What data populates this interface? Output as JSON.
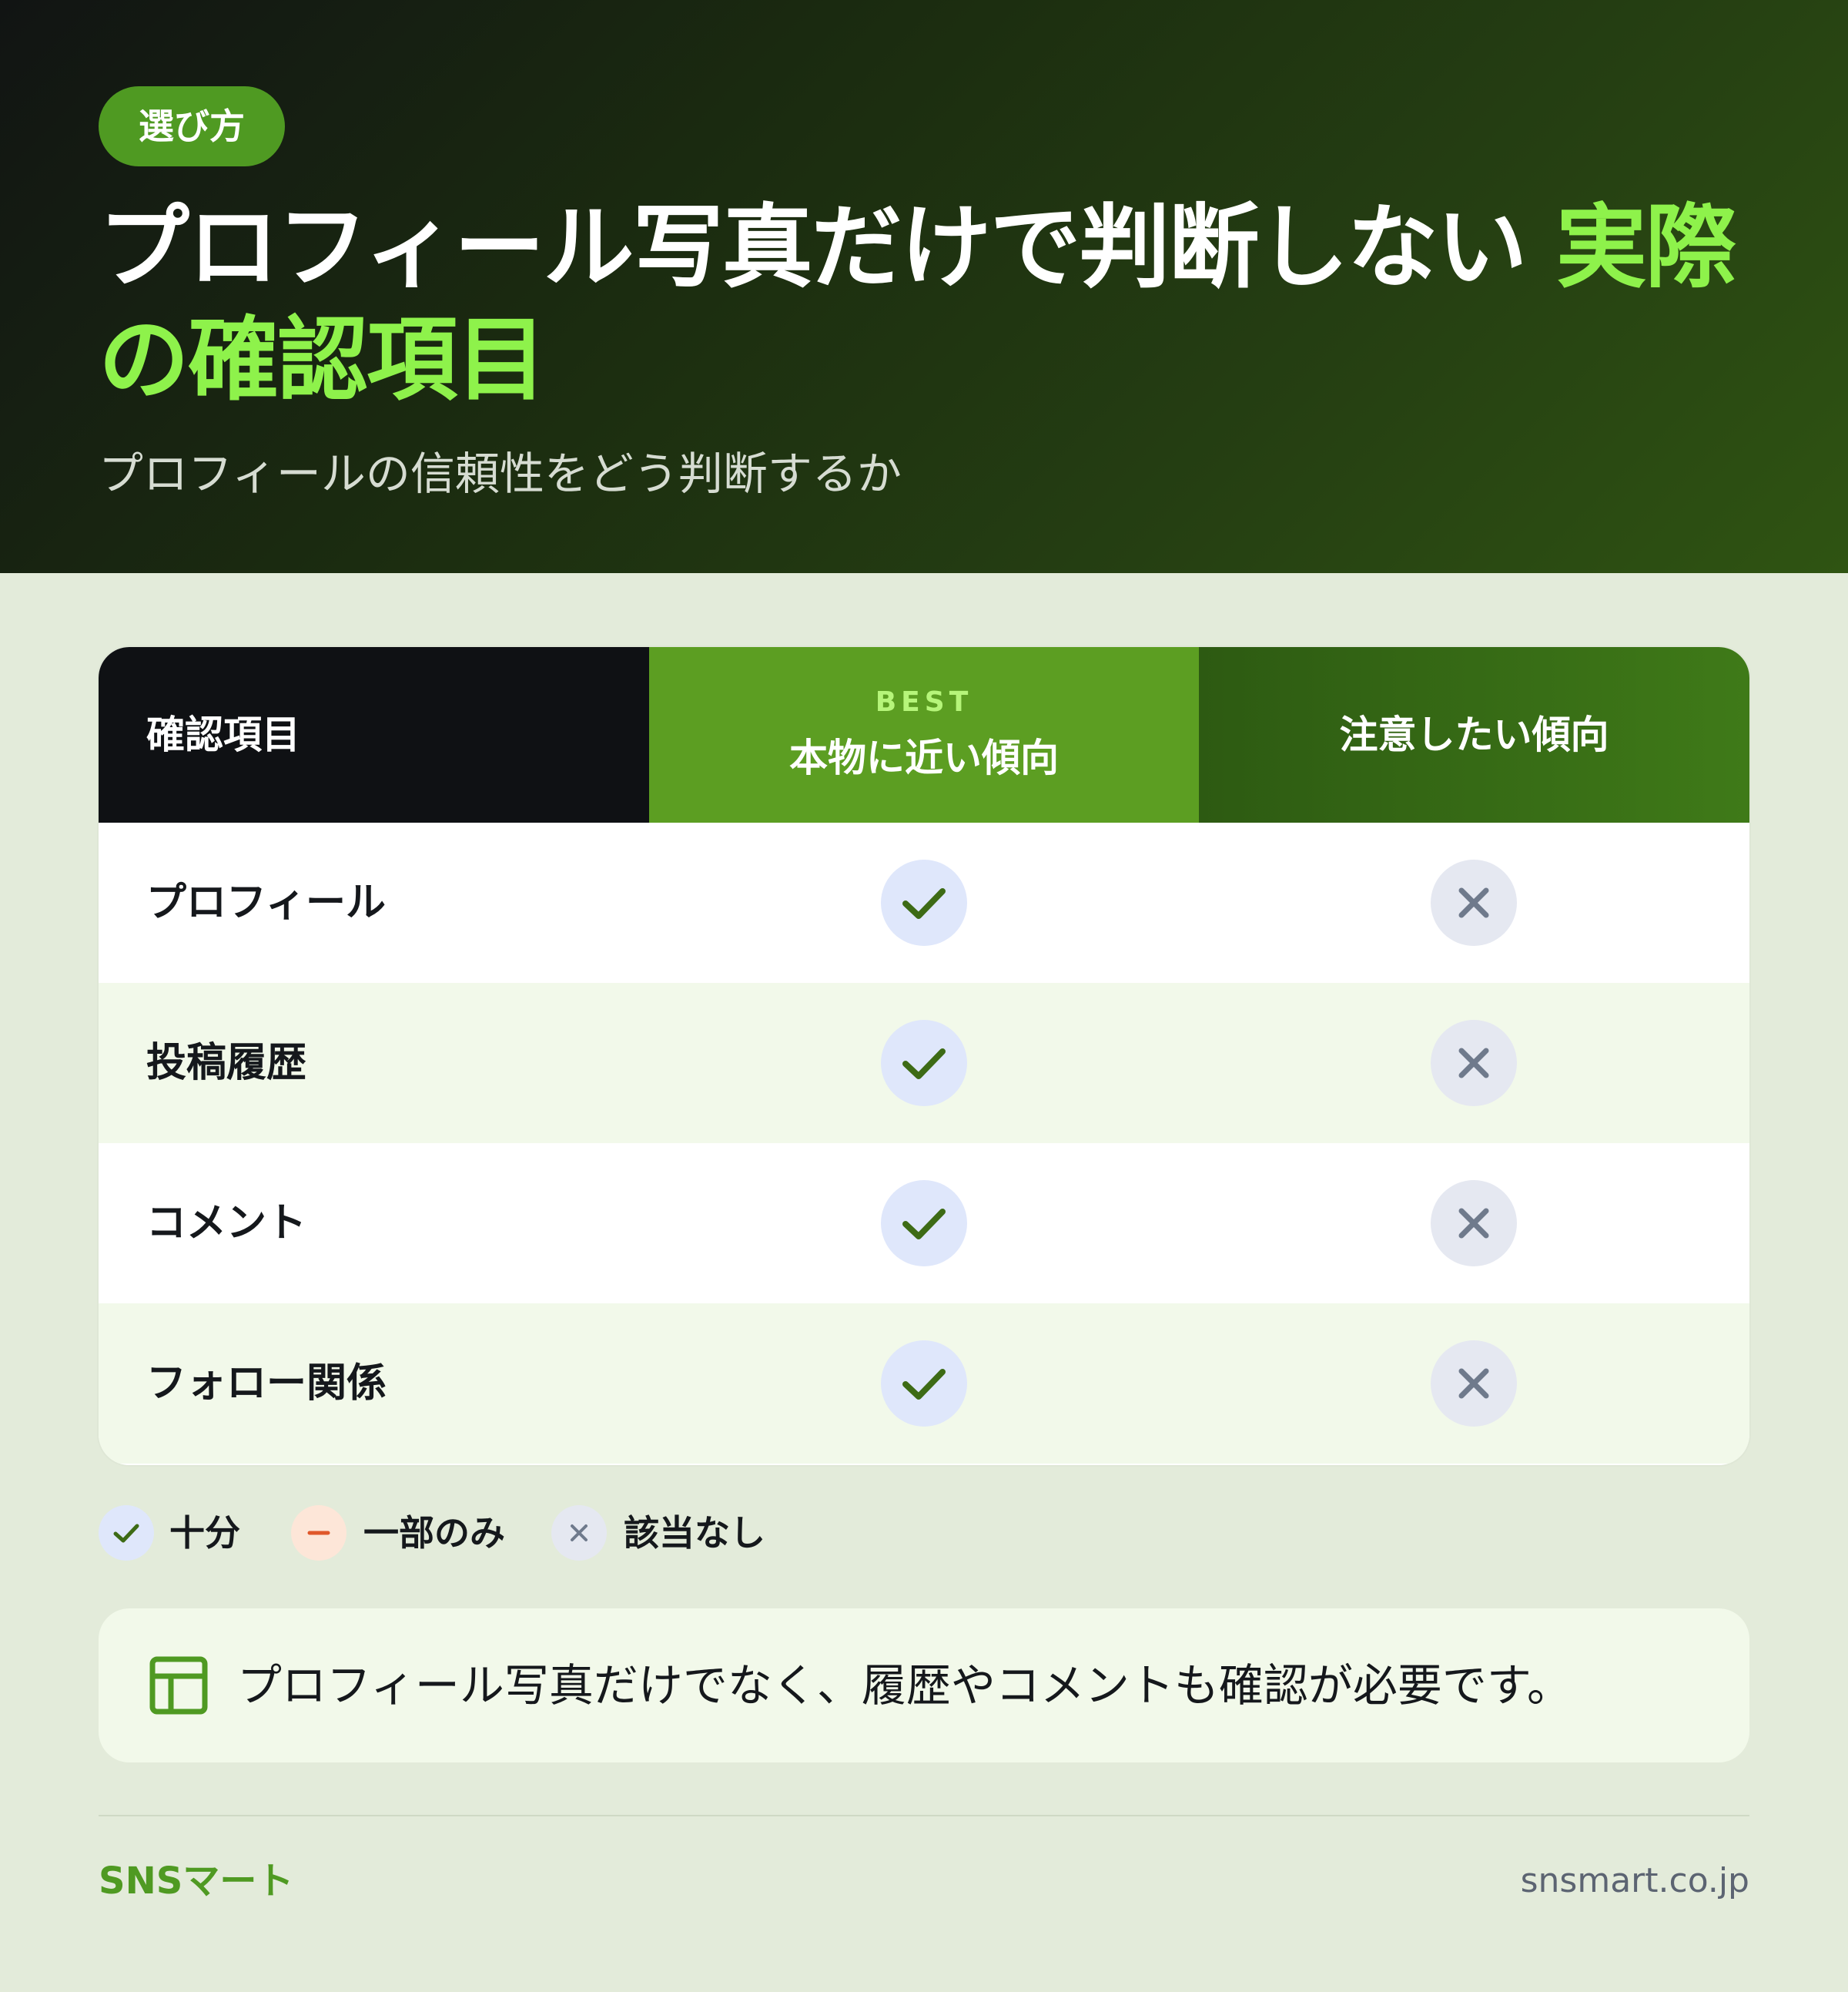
{
  "header": {
    "tag": "選び方",
    "title_main": "プロフィール写真だけで判断しない ",
    "title_highlight_1": "実際",
    "title_highlight_2": "の確認項目",
    "subtitle": "プロフィールの信頼性をどう判断するか"
  },
  "table": {
    "columns": {
      "item": "確認項目",
      "best_tag": "BEST",
      "genuine": "本物に近い傾向",
      "caution": "注意したい傾向"
    },
    "rows": [
      {
        "label": "プロフィール",
        "genuine": "check",
        "caution": "cross"
      },
      {
        "label": "投稿履歴",
        "genuine": "check",
        "caution": "cross"
      },
      {
        "label": "コメント",
        "genuine": "check",
        "caution": "cross"
      },
      {
        "label": "フォロー関係",
        "genuine": "check",
        "caution": "cross"
      }
    ]
  },
  "legend": {
    "full": "十分",
    "partial": "一部のみ",
    "none": "該当なし"
  },
  "note": {
    "icon": "layout-icon",
    "text": "プロフィール写真だけでなく、履歴やコメントも確認が必要です。"
  },
  "footer": {
    "brand": "SNSマート",
    "site": "snsmart.co.jp"
  },
  "colors": {
    "accent": "#8ef24b",
    "brand_green": "#4f9a22",
    "check_green": "#3d6b15",
    "cross_gray": "#6f7a8c",
    "partial_orange": "#e0572a"
  }
}
